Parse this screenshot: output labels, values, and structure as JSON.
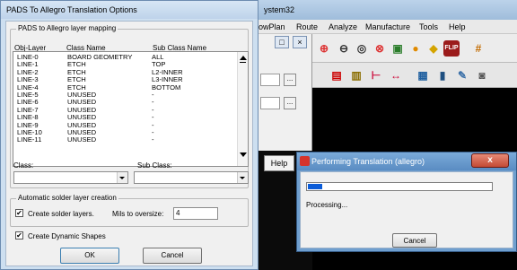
{
  "pads_dialog": {
    "title": "PADS To Allegro Translation Options",
    "mapping_group_label": "PADS to Allegro layer mapping",
    "columns": [
      "Obj-Layer",
      "Class Name",
      "Sub Class Name"
    ],
    "rows": [
      [
        "LINE-0",
        "BOARD GEOMETRY",
        "ALL"
      ],
      [
        "LINE-1",
        "ETCH",
        "TOP"
      ],
      [
        "LINE-2",
        "ETCH",
        "L2-INNER"
      ],
      [
        "LINE-3",
        "ETCH",
        "L3-INNER"
      ],
      [
        "LINE-4",
        "ETCH",
        "BOTTOM"
      ],
      [
        "LINE-5",
        "UNUSED",
        "-"
      ],
      [
        "LINE-6",
        "UNUSED",
        "-"
      ],
      [
        "LINE-7",
        "UNUSED",
        "-"
      ],
      [
        "LINE-8",
        "UNUSED",
        "-"
      ],
      [
        "LINE-9",
        "UNUSED",
        "-"
      ],
      [
        "LINE-10",
        "UNUSED",
        "-"
      ],
      [
        "LINE-11",
        "UNUSED",
        "-"
      ]
    ],
    "class_label": "Class:",
    "subclass_label": "Sub Class:",
    "class_value": "",
    "subclass_value": "",
    "solder_group_label": "Automatic solder layer creation",
    "create_solder_label": "Create solder layers.",
    "create_solder_checked": true,
    "mils_label": "Mils to oversize:",
    "mils_value": "4",
    "dynamic_shapes_label": "Create Dynamic Shapes",
    "dynamic_shapes_checked": true,
    "ok_label": "OK",
    "cancel_label": "Cancel"
  },
  "background_app": {
    "title_fragment": "ystem32",
    "menus": [
      "owPlan",
      "Route",
      "Analyze",
      "Manufacture",
      "Tools",
      "Help"
    ],
    "help_button": "Help",
    "ellipsis_button": "..."
  },
  "progress_dialog": {
    "title": "Performing Translation (allegro)",
    "close_glyph": "x",
    "status_text": "Processing...",
    "progress_fraction": 0.08,
    "cancel_label": "Cancel"
  },
  "colors": {
    "progress_fill": "#0b5cd8",
    "progress_titlebar": "#5a8cc2",
    "close_button": "#c34a35"
  }
}
